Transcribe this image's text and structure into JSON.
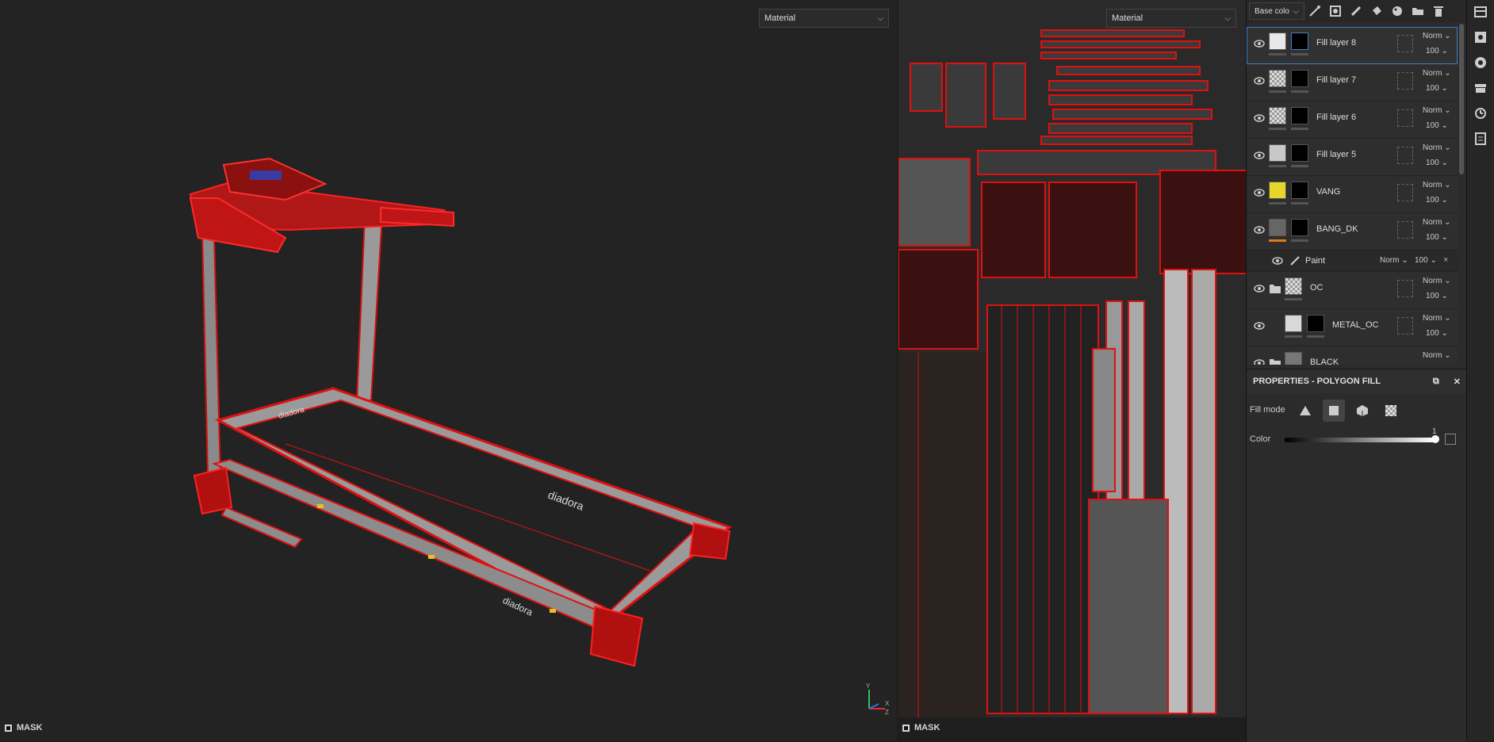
{
  "viewport3d": {
    "channel_dropdown": "Material",
    "mask_label": "MASK",
    "axis_labels": [
      "Y",
      "X",
      "Z"
    ]
  },
  "viewport2d": {
    "channel_dropdown": "Material",
    "mask_label": "MASK"
  },
  "toolbar": {
    "channel_select": "Base colo",
    "icons": [
      "magic-wand-icon",
      "smart-mask-icon",
      "brush-icon",
      "bucket-icon",
      "palette-icon",
      "folder-icon",
      "trash-icon"
    ]
  },
  "layers": [
    {
      "name": "Fill layer 8",
      "blend": "Norm",
      "opacity": "100",
      "selected": true,
      "thumb": "light"
    },
    {
      "name": "Fill layer 7",
      "blend": "Norm",
      "opacity": "100",
      "selected": false,
      "thumb": "checker"
    },
    {
      "name": "Fill layer 6",
      "blend": "Norm",
      "opacity": "100",
      "selected": false,
      "thumb": "checker"
    },
    {
      "name": "Fill layer 5",
      "blend": "Norm",
      "opacity": "100",
      "selected": false,
      "thumb": "grey"
    },
    {
      "name": "VANG",
      "blend": "Norm",
      "opacity": "100",
      "selected": false,
      "thumb": "yellow"
    },
    {
      "name": "BANG_DK",
      "blend": "Norm",
      "opacity": "100",
      "selected": false,
      "thumb": "texture"
    }
  ],
  "sublayer": {
    "name": "Paint",
    "blend": "Norm",
    "opacity": "100"
  },
  "layers2": [
    {
      "name": "OC",
      "blend": "Norm",
      "opacity": "100",
      "folder": true
    },
    {
      "name": "METAL_OC",
      "blend": "Norm",
      "opacity": "100",
      "folder": false
    },
    {
      "name": "BLACK",
      "blend": "Norm",
      "opacity": "100",
      "folder": true
    }
  ],
  "properties": {
    "title": "PROPERTIES - POLYGON FILL",
    "fill_mode_label": "Fill mode",
    "color_label": "Color",
    "color_value": "1",
    "fill_modes": [
      "triangle-fill-icon",
      "mesh-fill-icon",
      "object-fill-icon",
      "uv-chunk-fill-icon"
    ]
  },
  "colors": {
    "wire": "#e01010",
    "accent": "#3f7fc8",
    "yellow": "#e6d62a",
    "orange": "#e07a20"
  }
}
